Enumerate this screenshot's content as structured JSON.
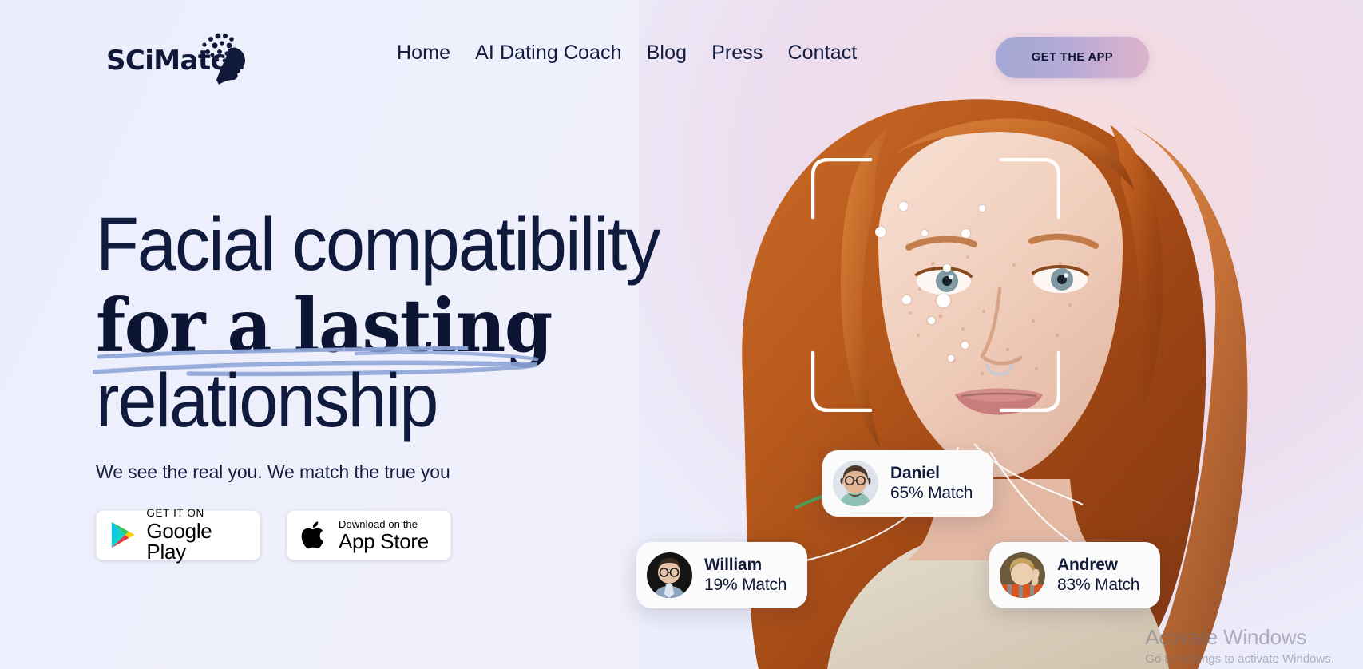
{
  "brand": {
    "name": "SCiMatch",
    "logo_icon": "brain-dots-face-profile-icon"
  },
  "nav": {
    "items": [
      {
        "label": "Home"
      },
      {
        "label": "AI Dating Coach"
      },
      {
        "label": "Blog"
      },
      {
        "label": "Press"
      },
      {
        "label": "Contact"
      }
    ],
    "cta_label": "GET THE APP"
  },
  "hero": {
    "headline_line1": "Facial compatibility",
    "headline_line2": "for a lasting",
    "headline_line3": "relationship",
    "tagline": "We see the real you. We match the true you"
  },
  "stores": [
    {
      "small": "GET IT ON",
      "big": "Google Play",
      "icon": "google-play-icon"
    },
    {
      "small": "Download on the",
      "big": "App Store",
      "icon": "apple-logo-icon"
    }
  ],
  "matches": [
    {
      "name": "Daniel",
      "match": "65% Match",
      "avatar": "avatar-daniel"
    },
    {
      "name": "William",
      "match": "19% Match",
      "avatar": "avatar-william"
    },
    {
      "name": "Andrew",
      "match": "83% Match",
      "avatar": "avatar-andrew"
    }
  ],
  "watermark": {
    "line1": "Activate Windows",
    "line2": "Go to Settings to activate Windows."
  },
  "colors": {
    "ink": "#0f1a3c",
    "background": "#eff0fb",
    "swoosh": "#8fa5d8",
    "cta_gradient_from": "#a3a8d4",
    "cta_gradient_to": "#dcb2cb"
  }
}
